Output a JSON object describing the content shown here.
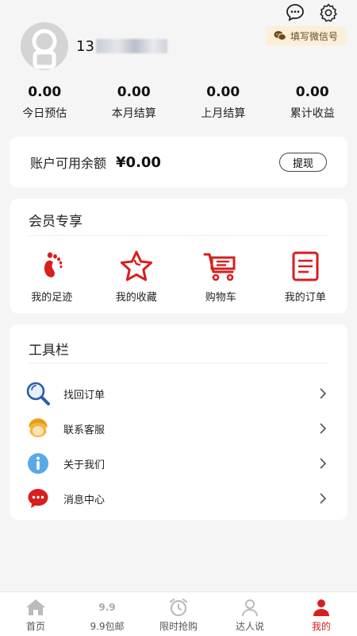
{
  "header": {
    "phone_prefix": "13",
    "wechat_button": "填写微信号",
    "icons": [
      "chat-icon",
      "settings-icon"
    ]
  },
  "stats": [
    {
      "value": "0.00",
      "label": "今日预估"
    },
    {
      "value": "0.00",
      "label": "本月结算"
    },
    {
      "value": "0.00",
      "label": "上月结算"
    },
    {
      "value": "0.00",
      "label": "累计收益"
    }
  ],
  "balance": {
    "label": "账户可用余额",
    "amount": "¥0.00",
    "withdraw_button": "提现"
  },
  "member": {
    "title": "会员专享",
    "items": [
      {
        "label": "我的足迹",
        "icon": "footprint-icon"
      },
      {
        "label": "我的收藏",
        "icon": "star-icon"
      },
      {
        "label": "购物车",
        "icon": "cart-icon"
      },
      {
        "label": "我的订单",
        "icon": "order-icon"
      }
    ]
  },
  "tools": {
    "title": "工具栏",
    "items": [
      {
        "label": "找回订单",
        "icon": "search-icon"
      },
      {
        "label": "联系客服",
        "icon": "support-agent-icon"
      },
      {
        "label": "关于我们",
        "icon": "info-icon"
      },
      {
        "label": "消息中心",
        "icon": "message-icon"
      }
    ]
  },
  "tabbar": {
    "items": [
      {
        "label": "首页",
        "icon_text": ""
      },
      {
        "label": "9.9包邮",
        "icon_text": "9.9"
      },
      {
        "label": "限时抢购",
        "icon_text": ""
      },
      {
        "label": "达人说",
        "icon_text": ""
      },
      {
        "label": "我的",
        "icon_text": ""
      }
    ],
    "active_index": 4
  },
  "colors": {
    "accent": "#d81e1e",
    "background": "#f5f5f5",
    "wechat_pill": "#fbefd8"
  }
}
